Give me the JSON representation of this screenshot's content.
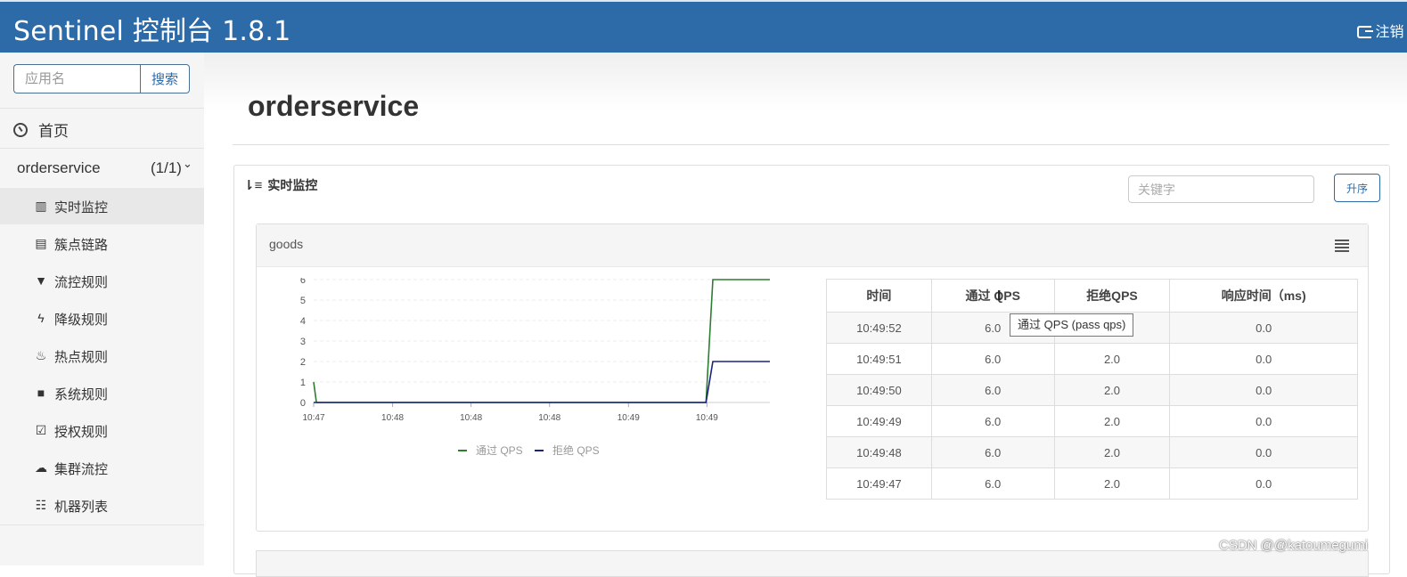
{
  "header": {
    "title": "Sentinel 控制台 1.8.1",
    "logout_label": "注销"
  },
  "sidebar": {
    "search_placeholder": "应用名",
    "search_button": "搜索",
    "home_label": "首页",
    "app": {
      "name": "orderservice",
      "count": "(1/1)"
    },
    "items": [
      {
        "icon": "bar-chart-icon",
        "label": "实时监控",
        "active": true
      },
      {
        "icon": "list-icon",
        "label": "簇点链路"
      },
      {
        "icon": "filter-icon",
        "label": "流控规则"
      },
      {
        "icon": "flash-icon",
        "label": "降级规则"
      },
      {
        "icon": "fire-icon",
        "label": "热点规则"
      },
      {
        "icon": "lock-icon",
        "label": "系统规则"
      },
      {
        "icon": "check-square-icon",
        "label": "授权规则"
      },
      {
        "icon": "cloud-icon",
        "label": "集群流控"
      },
      {
        "icon": "th-list-icon",
        "label": "机器列表"
      }
    ]
  },
  "main": {
    "page_title": "orderservice",
    "panel_title": "实时监控",
    "keyword_placeholder": "关键字",
    "sort_button": "升序",
    "resource": {
      "name": "goods",
      "tooltip": "通过 QPS (pass qps)",
      "table": {
        "headers": [
          "时间",
          "通过 QPS",
          "拒绝QPS",
          "响应时间（ms)"
        ],
        "rows": [
          [
            "10:49:52",
            "6.0",
            "",
            "0.0"
          ],
          [
            "10:49:51",
            "6.0",
            "2.0",
            "0.0"
          ],
          [
            "10:49:50",
            "6.0",
            "2.0",
            "0.0"
          ],
          [
            "10:49:49",
            "6.0",
            "2.0",
            "0.0"
          ],
          [
            "10:49:48",
            "6.0",
            "2.0",
            "0.0"
          ],
          [
            "10:49:47",
            "6.0",
            "2.0",
            "0.0"
          ]
        ]
      }
    }
  },
  "chart_data": {
    "type": "line",
    "x_ticks": [
      "10:47",
      "10:48",
      "10:48",
      "10:48",
      "10:49",
      "10:49"
    ],
    "y_ticks": [
      0,
      1,
      2,
      3,
      4,
      5,
      6
    ],
    "ylim": [
      0,
      6
    ],
    "series": [
      {
        "name": "通过 QPS",
        "color": "#2e7d32",
        "points": [
          [
            0,
            1
          ],
          [
            0.006,
            0
          ],
          [
            0.86,
            0
          ],
          [
            0.875,
            6
          ],
          [
            1,
            6
          ]
        ]
      },
      {
        "name": "拒绝 QPS",
        "color": "#1a237e",
        "points": [
          [
            0,
            0
          ],
          [
            0.86,
            0
          ],
          [
            0.875,
            2
          ],
          [
            1,
            2
          ]
        ]
      }
    ]
  },
  "watermark": "CSDN @@katoumegumi"
}
